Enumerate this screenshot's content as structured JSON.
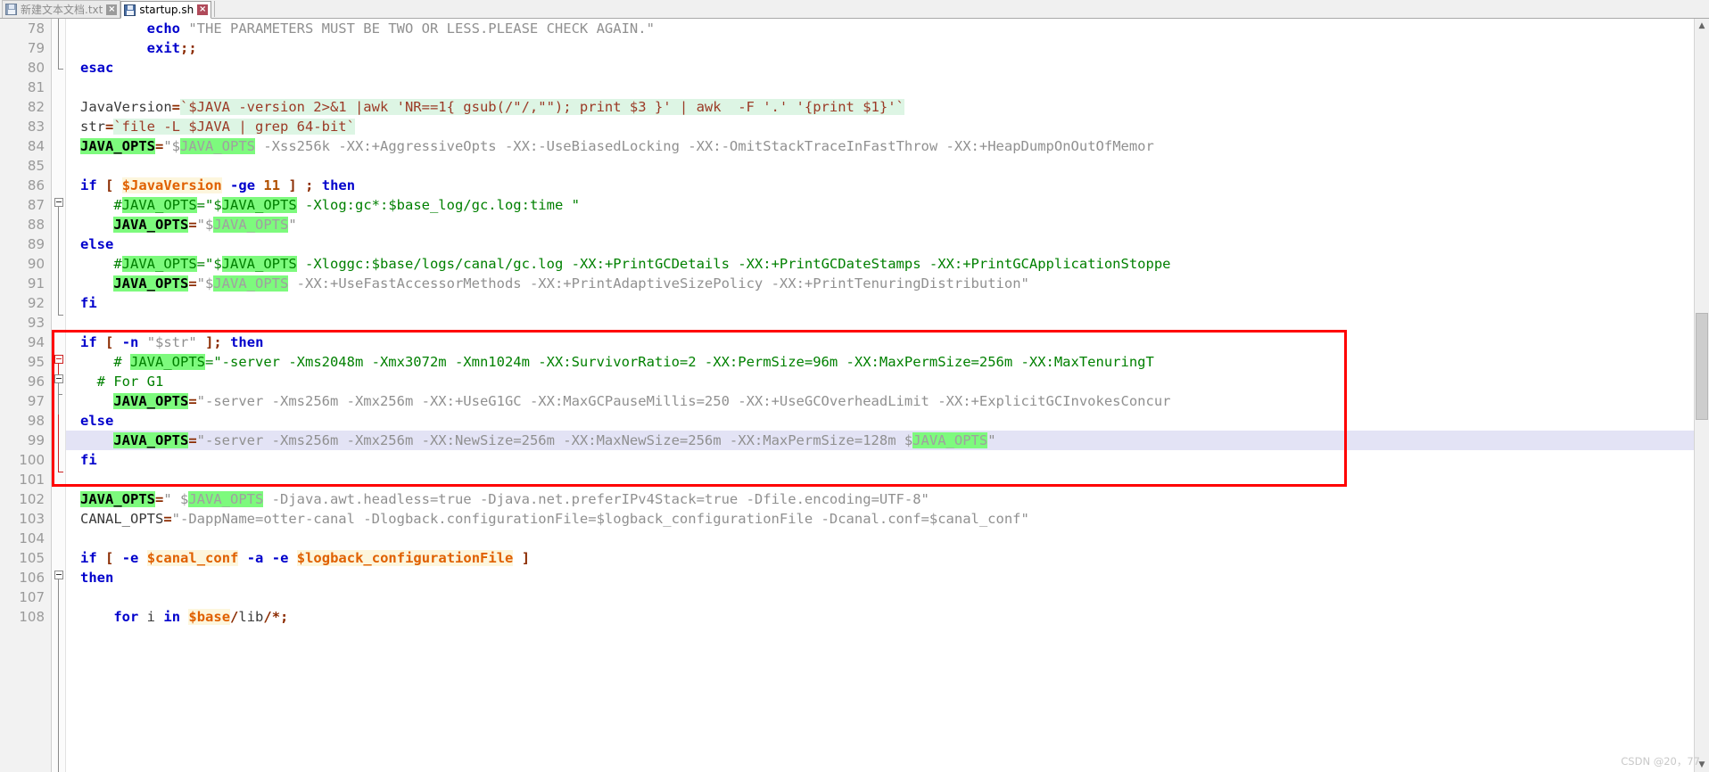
{
  "window": {
    "title": "startup.sh"
  },
  "tabs": [
    {
      "label": "新建文本文档.txt",
      "active": false,
      "icon": "floppy-disk-icon",
      "close": "×"
    },
    {
      "label": "startup.sh",
      "active": true,
      "icon": "floppy-disk-icon",
      "close": "×"
    }
  ],
  "gutter": {
    "first_line": 78,
    "last_line": 108,
    "numbers": [
      78,
      79,
      80,
      81,
      82,
      83,
      84,
      85,
      86,
      87,
      88,
      89,
      90,
      91,
      92,
      93,
      94,
      95,
      96,
      97,
      98,
      99,
      100,
      101,
      102,
      103,
      104,
      105,
      106,
      107,
      108
    ]
  },
  "colors": {
    "keyword": "#0000cc",
    "comment": "#008000",
    "variable": "#e06000",
    "variable_bg": "#fdf6dd",
    "string": "#909090",
    "operator": "#8b2b00",
    "occurrence_highlight": "#7dfa7d",
    "backtick_bg": "#ddf5e4",
    "current_line_bg": "#e3e3f5",
    "annotation_box": "#ff0000",
    "gutter_bg": "#f2f2f2",
    "gutter_text": "#9a9a9a"
  },
  "code": {
    "lines": [
      {
        "n": 78,
        "text": "        echo \"THE PARAMETERS MUST BE TWO OR LESS.PLEASE CHECK AGAIN.\""
      },
      {
        "n": 79,
        "text": "        exit;;"
      },
      {
        "n": 80,
        "text": "esac"
      },
      {
        "n": 81,
        "text": ""
      },
      {
        "n": 82,
        "text": "JavaVersion=`$JAVA -version 2>&1 |awk 'NR==1{ gsub(/\"/,\"\"); print $3 }' | awk  -F '.' '{print $1}'`"
      },
      {
        "n": 83,
        "text": "str=`file -L $JAVA | grep 64-bit`"
      },
      {
        "n": 84,
        "text": "JAVA_OPTS=\"$JAVA_OPTS -Xss256k -XX:+AggressiveOpts -XX:-UseBiasedLocking -XX:-OmitStackTraceInFastThrow -XX:+HeapDumpOnOutOfMemor"
      },
      {
        "n": 85,
        "text": ""
      },
      {
        "n": 86,
        "text": "if [ $JavaVersion -ge 11 ] ; then"
      },
      {
        "n": 87,
        "text": "    #JAVA_OPTS=\"$JAVA_OPTS -Xlog:gc*:$base_log/gc.log:time \""
      },
      {
        "n": 88,
        "text": "    JAVA_OPTS=\"$JAVA_OPTS\""
      },
      {
        "n": 89,
        "text": "else"
      },
      {
        "n": 90,
        "text": "    #JAVA_OPTS=\"$JAVA_OPTS -Xloggc:$base/logs/canal/gc.log -XX:+PrintGCDetails -XX:+PrintGCDateStamps -XX:+PrintGCApplicationStoppe"
      },
      {
        "n": 91,
        "text": "    JAVA_OPTS=\"$JAVA_OPTS -XX:+UseFastAccessorMethods -XX:+PrintAdaptiveSizePolicy -XX:+PrintTenuringDistribution\""
      },
      {
        "n": 92,
        "text": "fi"
      },
      {
        "n": 93,
        "text": ""
      },
      {
        "n": 94,
        "text": "if [ -n \"$str\" ]; then"
      },
      {
        "n": 95,
        "text": "    # JAVA_OPTS=\"-server -Xms2048m -Xmx3072m -Xmn1024m -XX:SurvivorRatio=2 -XX:PermSize=96m -XX:MaxPermSize=256m -XX:MaxTenuringT"
      },
      {
        "n": 96,
        "text": "  # For G1"
      },
      {
        "n": 97,
        "text": "    JAVA_OPTS=\"-server -Xms256m -Xmx256m -XX:+UseG1GC -XX:MaxGCPauseMillis=250 -XX:+UseGCOverheadLimit -XX:+ExplicitGCInvokesConcur"
      },
      {
        "n": 98,
        "text": "else"
      },
      {
        "n": 99,
        "text": "    JAVA_OPTS=\"-server -Xms256m -Xmx256m -XX:NewSize=256m -XX:MaxNewSize=256m -XX:MaxPermSize=128m $JAVA_OPTS\""
      },
      {
        "n": 100,
        "text": "fi"
      },
      {
        "n": 101,
        "text": ""
      },
      {
        "n": 102,
        "text": "JAVA_OPTS=\" $JAVA_OPTS -Djava.awt.headless=true -Djava.net.preferIPv4Stack=true -Dfile.encoding=UTF-8\""
      },
      {
        "n": 103,
        "text": "CANAL_OPTS=\"-DappName=otter-canal -Dlogback.configurationFile=$logback_configurationFile -Dcanal.conf=$canal_conf\""
      },
      {
        "n": 104,
        "text": ""
      },
      {
        "n": 105,
        "text": "if [ -e $canal_conf -a -e $logback_configurationFile ]"
      },
      {
        "n": 106,
        "text": "then"
      },
      {
        "n": 107,
        "text": ""
      },
      {
        "n": 108,
        "text": "    for i in $base/lib/*;"
      }
    ]
  },
  "annotation": {
    "type": "red-rectangle",
    "covers_lines": "94-100"
  },
  "watermark": "CSDN @20，77",
  "scrollbar": {
    "up_arrow": "▲",
    "down_arrow": "▼"
  }
}
